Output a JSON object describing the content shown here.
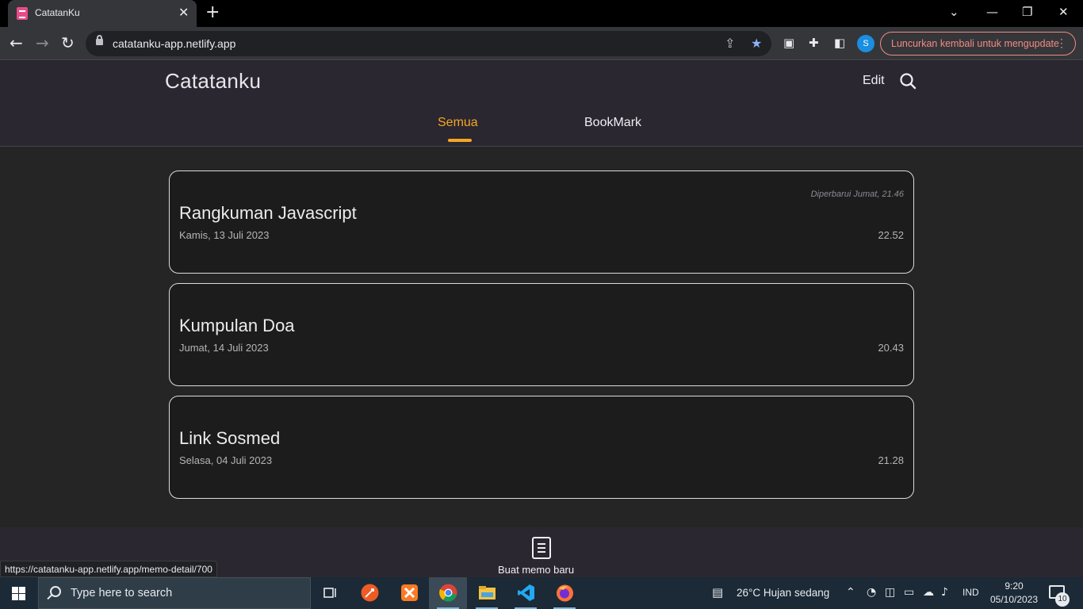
{
  "browser": {
    "tab_title": "CatatanKu",
    "tab_close": "✕",
    "new_tab": "+",
    "window_controls": {
      "list": "⌄",
      "minimize": "—",
      "restore": "❐",
      "close": "✕"
    },
    "nav": {
      "back": "←",
      "forward": "→",
      "reload": "↻"
    },
    "url": "catatanku-app.netlify.app",
    "profile_initial": "S",
    "relaunch_label": "Luncurkan kembali untuk mengupdate",
    "relaunch_menu": "⋮",
    "status_url": "https://catatanku-app.netlify.app/memo-detail/700"
  },
  "app": {
    "brand": "Catatanku",
    "edit_label": "Edit",
    "tabs": [
      {
        "label": "Semua",
        "active": true
      },
      {
        "label": "BookMark",
        "active": false
      }
    ],
    "accent_color": "#f5a623",
    "notes": [
      {
        "updated": "Diperbarui Jumat, 21.46",
        "title": "Rangkuman Javascript",
        "date": "Kamis, 13 Juli 2023",
        "time": "22.52"
      },
      {
        "updated": "",
        "title": "Kumpulan Doa",
        "date": "Jumat, 14 Juli 2023",
        "time": "20.43"
      },
      {
        "updated": "",
        "title": "Link Sosmed",
        "date": "Selasa, 04 Juli 2023",
        "time": "21.28"
      }
    ],
    "new_memo_label": "Buat memo baru"
  },
  "taskbar": {
    "search_placeholder": "Type here to search",
    "apps": [
      "task-view-icon",
      "postman-icon",
      "xampp-icon",
      "chrome-icon",
      "file-explorer-icon",
      "vscode-icon",
      "firefox-icon"
    ],
    "weather": "26°C  Hujan sedang",
    "language": "IND",
    "time": "9:20",
    "date": "05/10/2023",
    "notification_count": "10"
  }
}
